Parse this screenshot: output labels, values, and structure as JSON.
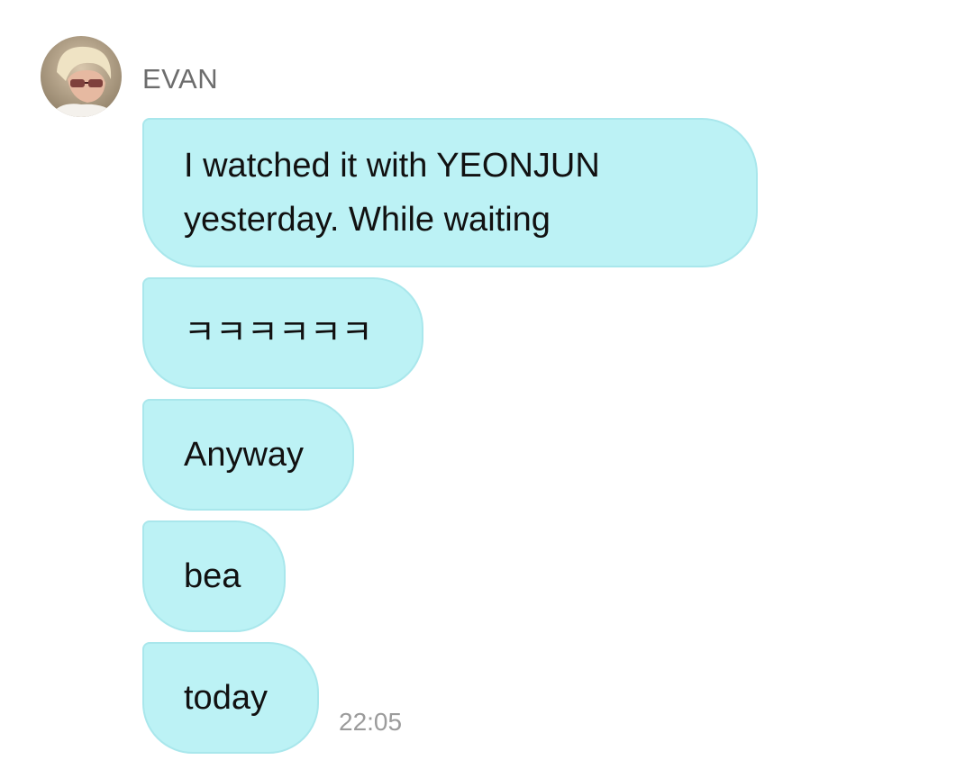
{
  "conversation": {
    "sender_name": "EVAN",
    "avatar_icon": "user-avatar-photo",
    "bubble_color": "#bcf2f5",
    "messages": [
      {
        "text": "I watched it with YEONJUN\nyesterday. While waiting"
      },
      {
        "text": "ㅋㅋㅋㅋㅋㅋ"
      },
      {
        "text": "Anyway"
      },
      {
        "text": "bea"
      },
      {
        "text": "today"
      }
    ],
    "timestamp": "22:05"
  }
}
